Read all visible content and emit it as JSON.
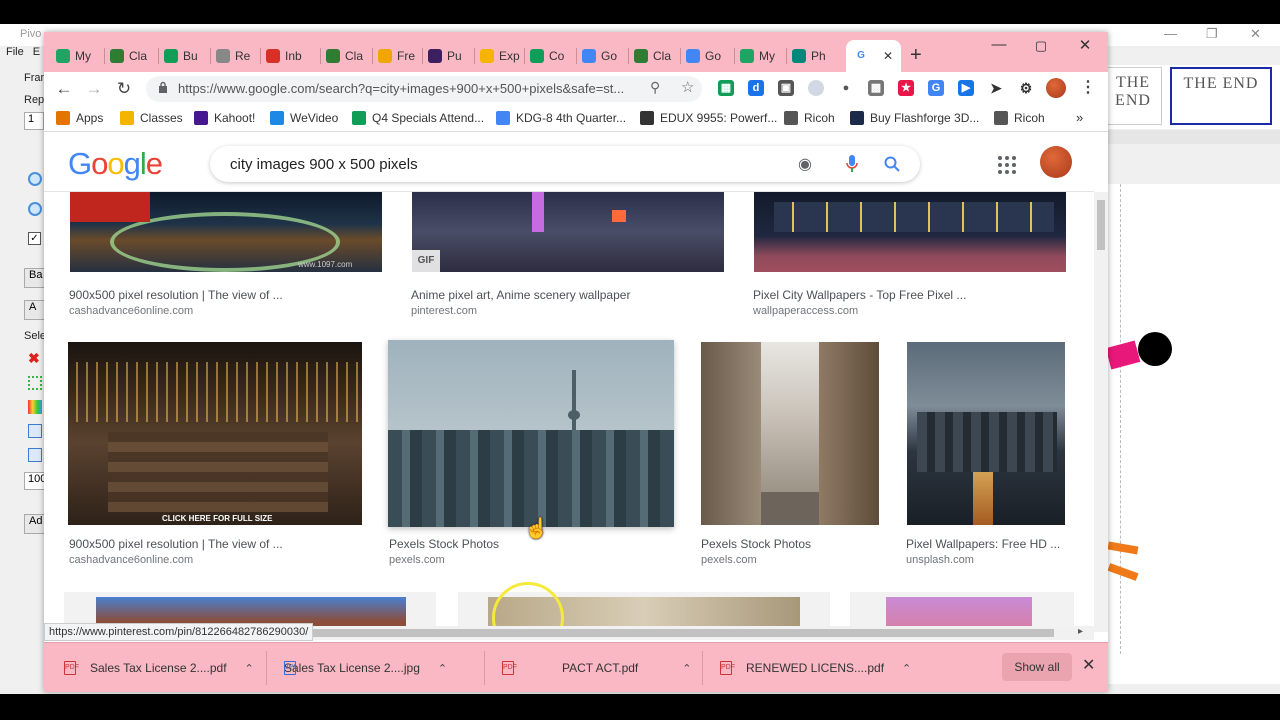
{
  "pivot": {
    "title": "Pivo",
    "menu": [
      "File",
      "E"
    ],
    "left": {
      "label_frame": "Fran",
      "label_rep": "Rep",
      "rep_value": "1",
      "btn_ba": "Ba",
      "btn_a": "A",
      "label_sele": "Sele",
      "zoom_value": "100",
      "btn_ad": "Ad"
    },
    "frames": [
      "THE END",
      "THE END"
    ]
  },
  "chrome": {
    "tabs": [
      {
        "label": "My",
        "icon": "google-drive-icon",
        "color": "#1fa463"
      },
      {
        "label": "Cla",
        "icon": "google-classroom-icon",
        "color": "#2e7d32"
      },
      {
        "label": "Bu",
        "icon": "google-sheets-icon",
        "color": "#0f9d58"
      },
      {
        "label": "Re",
        "icon": "generic-page-icon",
        "color": "#888888"
      },
      {
        "label": "Inb",
        "icon": "gmail-icon",
        "color": "#d93025"
      },
      {
        "label": "Cla",
        "icon": "google-classroom-icon",
        "color": "#2e7d32"
      },
      {
        "label": "Fre",
        "icon": "freckle-icon",
        "color": "#f0a500"
      },
      {
        "label": "Pu",
        "icon": "pear-deck-icon",
        "color": "#3b1f5e"
      },
      {
        "label": "Exp",
        "icon": "classes-icon",
        "color": "#f4b400"
      },
      {
        "label": "Co",
        "icon": "google-sheets-icon",
        "color": "#0f9d58"
      },
      {
        "label": "Go",
        "icon": "google-calendar-icon",
        "color": "#4285f4"
      },
      {
        "label": "Cla",
        "icon": "google-classroom-icon",
        "color": "#2e7d32"
      },
      {
        "label": "Go",
        "icon": "google-translate-icon",
        "color": "#4285f4"
      },
      {
        "label": "My",
        "icon": "google-drive-icon",
        "color": "#1fa463"
      },
      {
        "label": "Ph",
        "icon": "photo-icon",
        "color": "#00897b"
      },
      {
        "label": "G",
        "icon": "google-icon",
        "color": "#4285f4",
        "active": true
      }
    ],
    "url": "https://www.google.com/search?q=city+images+900+x+500+pixels&safe=st...",
    "bookmarks": [
      {
        "label": "Apps",
        "icon": "apps-grid-icon",
        "color": "#e37400"
      },
      {
        "label": "Classes",
        "icon": "classes-icon",
        "color": "#f4b400"
      },
      {
        "label": "Kahoot!",
        "icon": "kahoot-icon",
        "color": "#46178f"
      },
      {
        "label": "WeVideo",
        "icon": "wevideo-icon",
        "color": "#1e88e5"
      },
      {
        "label": "Q4 Specials Attend...",
        "icon": "google-sheets-icon",
        "color": "#0f9d58"
      },
      {
        "label": "KDG-8 4th Quarter...",
        "icon": "google-docs-icon",
        "color": "#4285f4"
      },
      {
        "label": "EDUX 9955: Powerf...",
        "icon": "globe-icon",
        "color": "#333333"
      },
      {
        "label": "Ricoh",
        "icon": "ricoh-icon",
        "color": "#555555"
      },
      {
        "label": "Buy Flashforge 3D...",
        "icon": "flashforge-icon",
        "color": "#1c2a4a"
      },
      {
        "label": "Ricoh",
        "icon": "ricoh-icon",
        "color": "#555555"
      }
    ]
  },
  "google": {
    "logo": "Google",
    "query": "city images 900 x 500 pixels",
    "results": [
      {
        "caption": "900x500 pixel resolution | The view of ...",
        "source": "cashadvance6online.com",
        "watermark": "www.1097.com"
      },
      {
        "caption": "Anime pixel art, Anime scenery wallpaper",
        "source": "pinterest.com",
        "badge": "GIF"
      },
      {
        "caption": "Pixel City Wallpapers - Top Free Pixel ...",
        "source": "wallpaperaccess.com"
      },
      {
        "caption": "900x500 pixel resolution | The view of ...",
        "source": "cashadvance6online.com",
        "overlay": "CLICK HERE FOR FULL SIZE"
      },
      {
        "caption": "Pexels Stock Photos",
        "source": "pexels.com"
      },
      {
        "caption": "Pexels Stock Photos",
        "source": "pexels.com"
      },
      {
        "caption": "Pixel Wallpapers: Free HD ...",
        "source": "unsplash.com"
      }
    ],
    "status_url": "https://www.pinterest.com/pin/812266482786290030/"
  },
  "downloads": {
    "items": [
      {
        "name": "Sales Tax License 2....pdf",
        "type": "pdf"
      },
      {
        "name": "Sales Tax License 2....jpg",
        "type": "jpg"
      },
      {
        "name": "PACT ACT.pdf",
        "type": "pdf"
      },
      {
        "name": "RENEWED LICENS....pdf",
        "type": "pdf"
      }
    ],
    "show_all": "Show all"
  }
}
